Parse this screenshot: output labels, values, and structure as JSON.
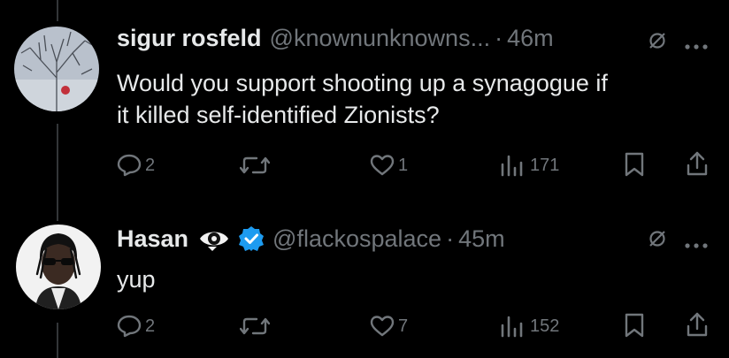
{
  "tweets": [
    {
      "name": "sigur rosfeld",
      "handle": "@knownunknowns...",
      "separator": "·",
      "time": "46m",
      "text_lines": [
        "Would you support shooting up a synagogue if",
        "it killed self-identified Zionists?"
      ],
      "actions": {
        "replies": "2",
        "reposts": "",
        "likes": "1",
        "views": "171"
      }
    },
    {
      "name": "Hasan",
      "handle": "@flackospalace",
      "separator": "·",
      "time": "45m",
      "text_lines": [
        "yup"
      ],
      "actions": {
        "replies": "2",
        "reposts": "",
        "likes": "7",
        "views": "152"
      }
    }
  ],
  "icons": {
    "reply": "reply-icon",
    "repost": "repost-icon",
    "like": "heart-icon",
    "views": "views-icon",
    "bookmark": "bookmark-icon",
    "share": "share-icon",
    "mute": "mute-icon",
    "more": "more-icon",
    "verified": "verified-badge-icon",
    "eye": "eye-emoji-icon"
  },
  "colors": {
    "background": "#000000",
    "text": "#e7e9ea",
    "secondary": "#71767b",
    "verified": "#1d9bf0"
  }
}
